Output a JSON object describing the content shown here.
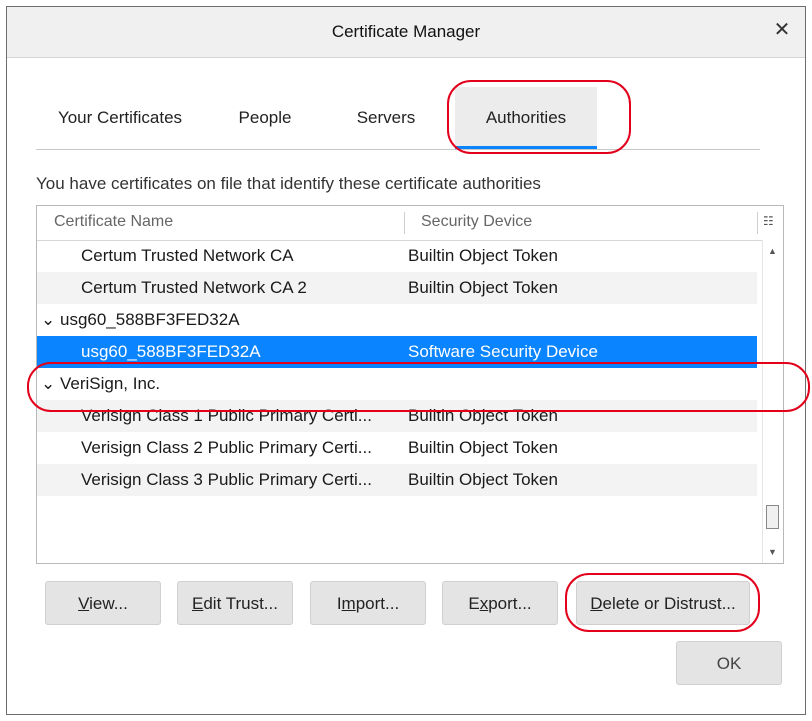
{
  "window": {
    "title": "Certificate Manager",
    "close_glyph": "✕"
  },
  "tabs": [
    {
      "label": "Your Certificates",
      "active": false
    },
    {
      "label": "People",
      "active": false
    },
    {
      "label": "Servers",
      "active": false
    },
    {
      "label": "Authorities",
      "active": true
    }
  ],
  "description": "You have certificates on file that identify these certificate authorities",
  "table": {
    "columns": [
      "Certificate Name",
      "Security Device"
    ],
    "column_picker_icon": "column-picker-icon",
    "rows": [
      {
        "kind": "cert",
        "name": "Certum Trusted Network CA",
        "device": "Builtin Object Token"
      },
      {
        "kind": "cert",
        "name": "Certum Trusted Network CA 2",
        "device": "Builtin Object Token"
      },
      {
        "kind": "group",
        "name": "usg60_588BF3FED32A"
      },
      {
        "kind": "cert",
        "name": "usg60_588BF3FED32A",
        "device": "Software Security Device",
        "selected": true
      },
      {
        "kind": "group",
        "name": "VeriSign, Inc."
      },
      {
        "kind": "cert",
        "name": "Verisign Class 1 Public Primary Certi...",
        "device": "Builtin Object Token"
      },
      {
        "kind": "cert",
        "name": "Verisign Class 2 Public Primary Certi...",
        "device": "Builtin Object Token"
      },
      {
        "kind": "cert",
        "name": "Verisign Class 3 Public Primary Certi...",
        "device": "Builtin Object Token"
      }
    ]
  },
  "buttons": [
    {
      "label": "View...",
      "accesskey_index": 0
    },
    {
      "label": "Edit Trust...",
      "accesskey_index": 0
    },
    {
      "label": "Import...",
      "accesskey_index": 1
    },
    {
      "label": "Export...",
      "accesskey_index": 1
    },
    {
      "label": "Delete or Distrust...",
      "accesskey_index": 0
    }
  ],
  "ok_label": "OK",
  "colors": {
    "accent": "#0a84ff",
    "highlight": "#e2001a"
  }
}
